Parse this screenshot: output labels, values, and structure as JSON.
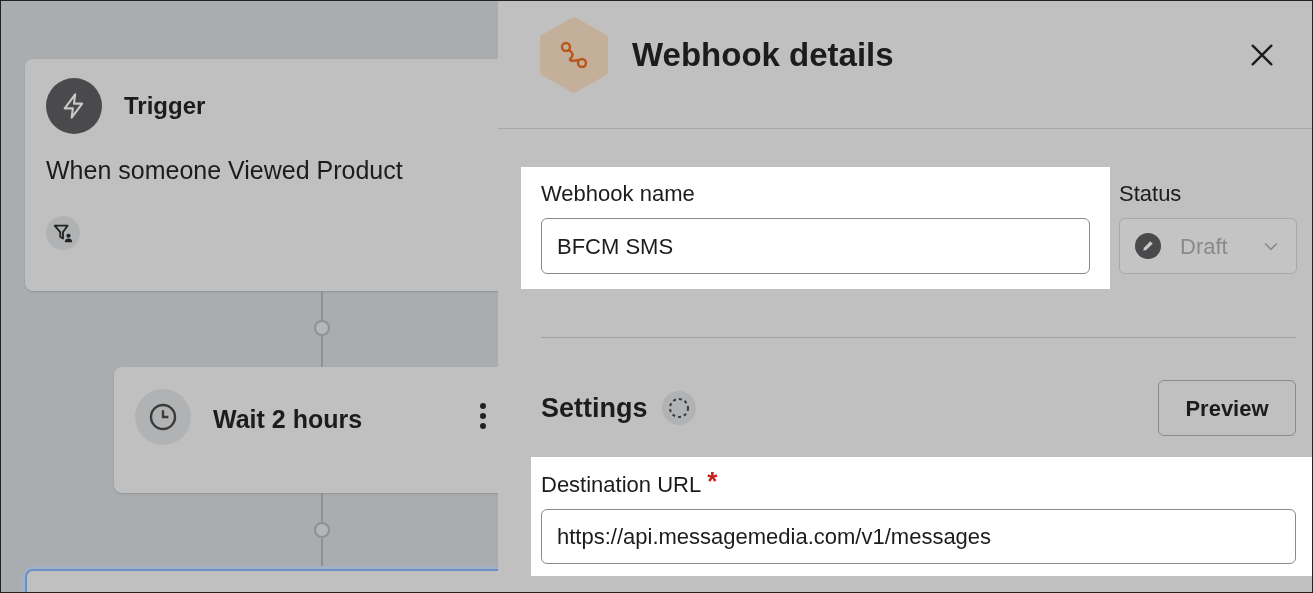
{
  "canvas": {
    "nodes": [
      {
        "kind": "trigger",
        "title": "Trigger",
        "description": "When someone Viewed Product"
      },
      {
        "kind": "wait",
        "title": "Wait 2 hours"
      }
    ]
  },
  "panel": {
    "title": "Webhook details",
    "name_field": {
      "label": "Webhook name",
      "value": "BFCM SMS",
      "highlighted": true
    },
    "status_field": {
      "label": "Status",
      "value": "Draft",
      "disabled": true
    },
    "settings": {
      "title": "Settings",
      "button": "Preview"
    },
    "url_field": {
      "label": "Destination URL",
      "required_mark": "*",
      "value": "https://api.messagemedia.com/v1/messages",
      "highlighted": true
    }
  }
}
